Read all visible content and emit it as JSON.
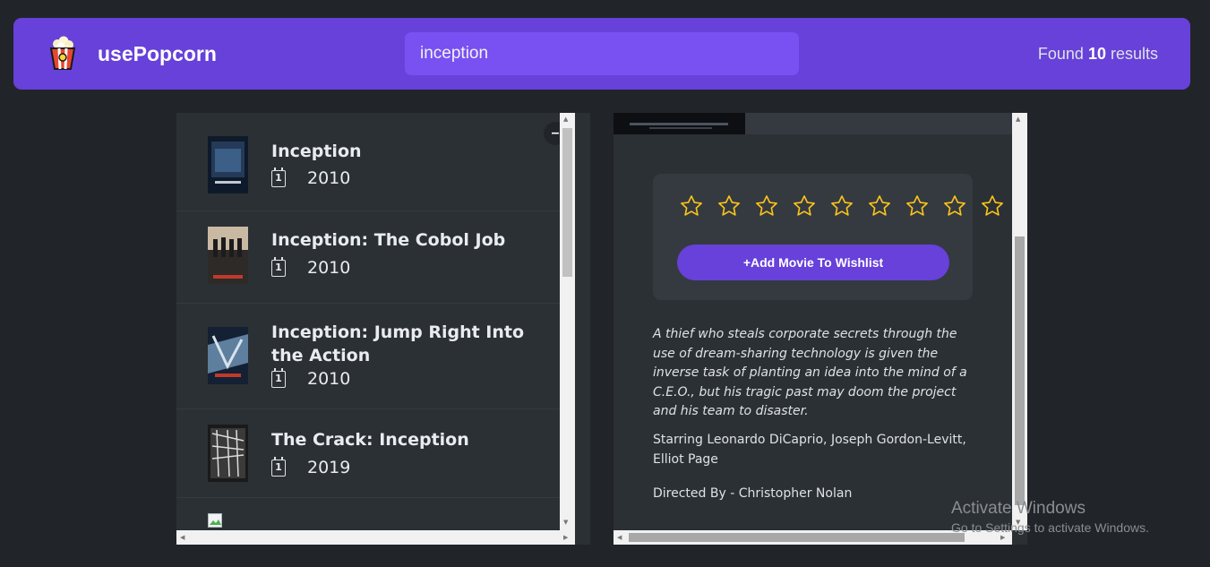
{
  "app": {
    "name": "usePopcorn",
    "icon": "popcorn-icon"
  },
  "search": {
    "value": "inception"
  },
  "results": {
    "prefix": "Found",
    "count": "10",
    "suffix": "results"
  },
  "movie_list": {
    "toggle_label": "–",
    "items": [
      {
        "title": "Inception",
        "year": "2010"
      },
      {
        "title": "Inception: The Cobol Job",
        "year": "2010"
      },
      {
        "title": "Inception: Jump Right Into the Action",
        "year": "2010"
      },
      {
        "title": "The Crack: Inception",
        "year": "2019"
      }
    ]
  },
  "details": {
    "rating_stars": 9,
    "wishlist_button": "+Add Movie To Wishlist",
    "plot": "A thief who steals corporate secrets through the use of dream-sharing technology is given the inverse task of planting an idea into the mind of a C.E.O., but his tragic past may doom the project and his team to disaster.",
    "starring": "Starring Leonardo DiCaprio, Joseph Gordon-Levitt, Elliot Page",
    "director": "Directed By - Christopher Nolan"
  },
  "watermark": {
    "line1": "Activate Windows",
    "line2": "Go to Settings to activate Windows."
  },
  "colors": {
    "background": "#212529",
    "primary": "#6741d9",
    "primary_light": "#7950f2",
    "box": "#2b3035",
    "star": "#fcc419"
  }
}
